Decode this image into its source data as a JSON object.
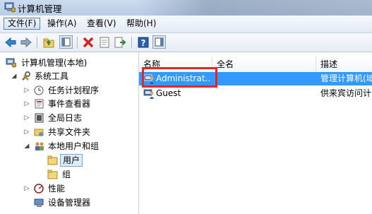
{
  "window": {
    "title": "计算机管理"
  },
  "menu": {
    "file": "文件(F)",
    "action": "操作(A)",
    "view": "查看(V)",
    "help": "帮助(H)"
  },
  "toolbar": {
    "icons": [
      "back-arrow-icon",
      "forward-arrow-icon",
      "up-folder-icon",
      "show-hide-tree-icon",
      "delete-icon",
      "properties-icon",
      "export-list-icon",
      "help-icon",
      "show-hide-action-pane-icon"
    ]
  },
  "tree": {
    "root": "计算机管理(本地)",
    "system_tools": "系统工具",
    "task_scheduler": "任务计划程序",
    "event_viewer": "事件查看器",
    "shared_folders": "共享文件夹",
    "local_users_groups": "本地用户和组",
    "users": "用户",
    "groups": "组",
    "performance": "性能",
    "device_manager": "设备管理器",
    "sys_log": "全局日志"
  },
  "list": {
    "columns": {
      "name": "名称",
      "fullname": "全名",
      "description": "描述"
    },
    "rows": [
      {
        "name": "Administrat...",
        "fullname": "",
        "description": "管理计算机(域)"
      },
      {
        "name": "Guest",
        "fullname": "",
        "description": "供来宾访问计"
      }
    ]
  },
  "colors": {
    "selection": "#3399ff",
    "highlight": "#e3262b"
  }
}
